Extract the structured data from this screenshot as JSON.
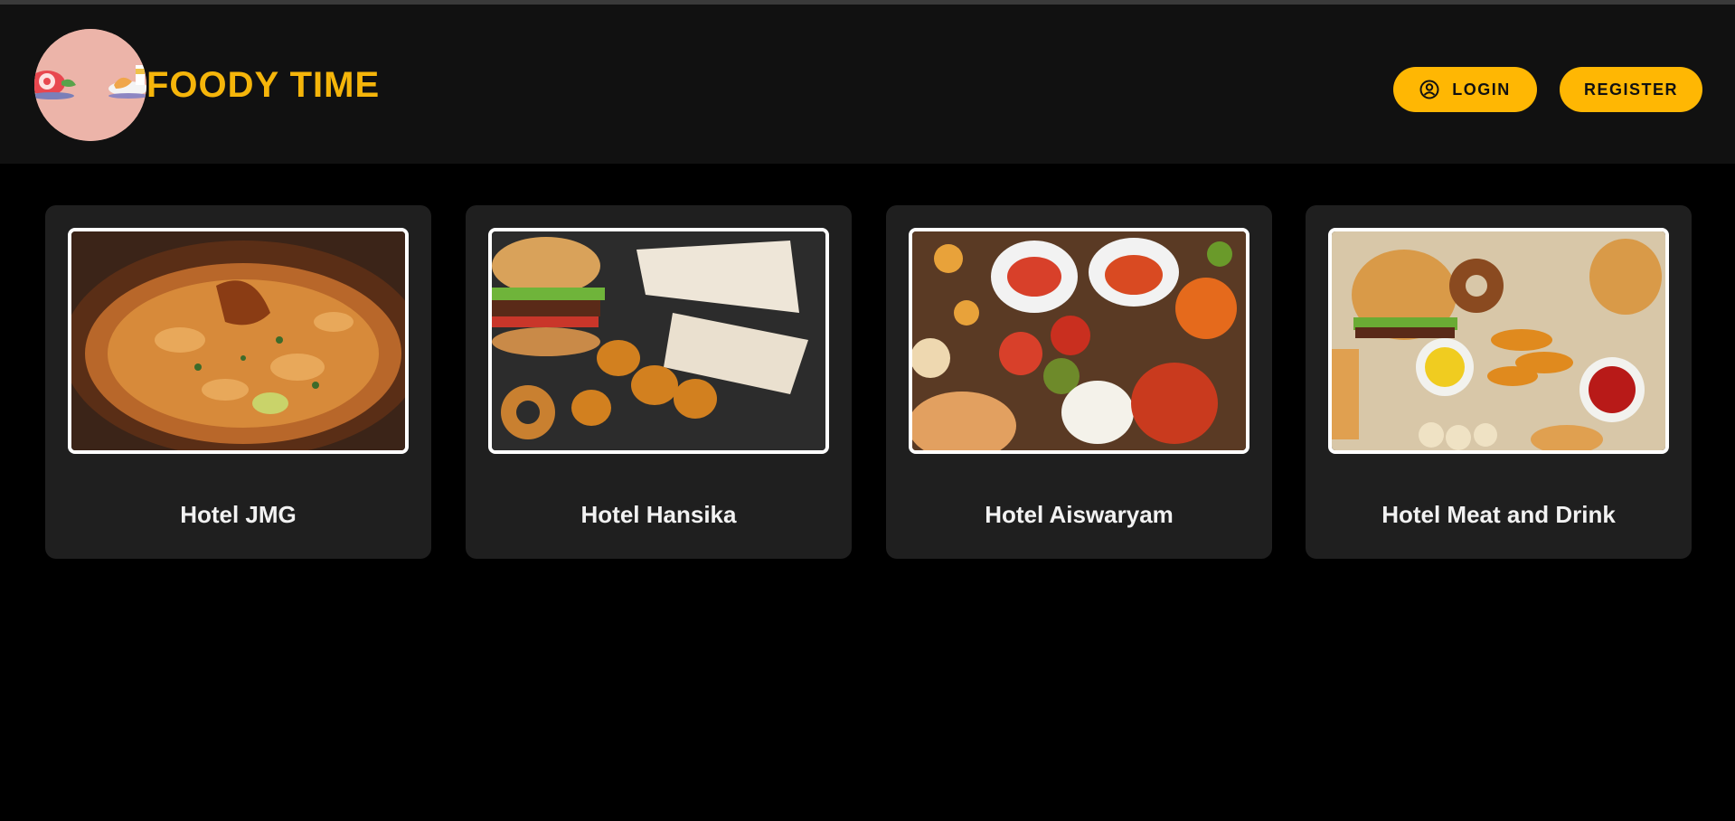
{
  "header": {
    "brand": "FOODY TIME",
    "logo_icon": "food-logo-icon",
    "login_label": "LOGIN",
    "login_icon": "user-circle-icon",
    "register_label": "REGISTER"
  },
  "colors": {
    "accent": "#ffb703",
    "brand_text": "#f5b50a",
    "header_bg": "#111111",
    "card_bg": "#1f1f1f",
    "page_bg": "#000000"
  },
  "hotels": [
    {
      "name": "Hotel JMG",
      "image": "biryani-image"
    },
    {
      "name": "Hotel Hansika",
      "image": "burger-wrap-image"
    },
    {
      "name": "Hotel Aiswaryam",
      "image": "indian-food-spread-image"
    },
    {
      "name": "Hotel Meat and Drink",
      "image": "fast-food-platter-image"
    }
  ]
}
